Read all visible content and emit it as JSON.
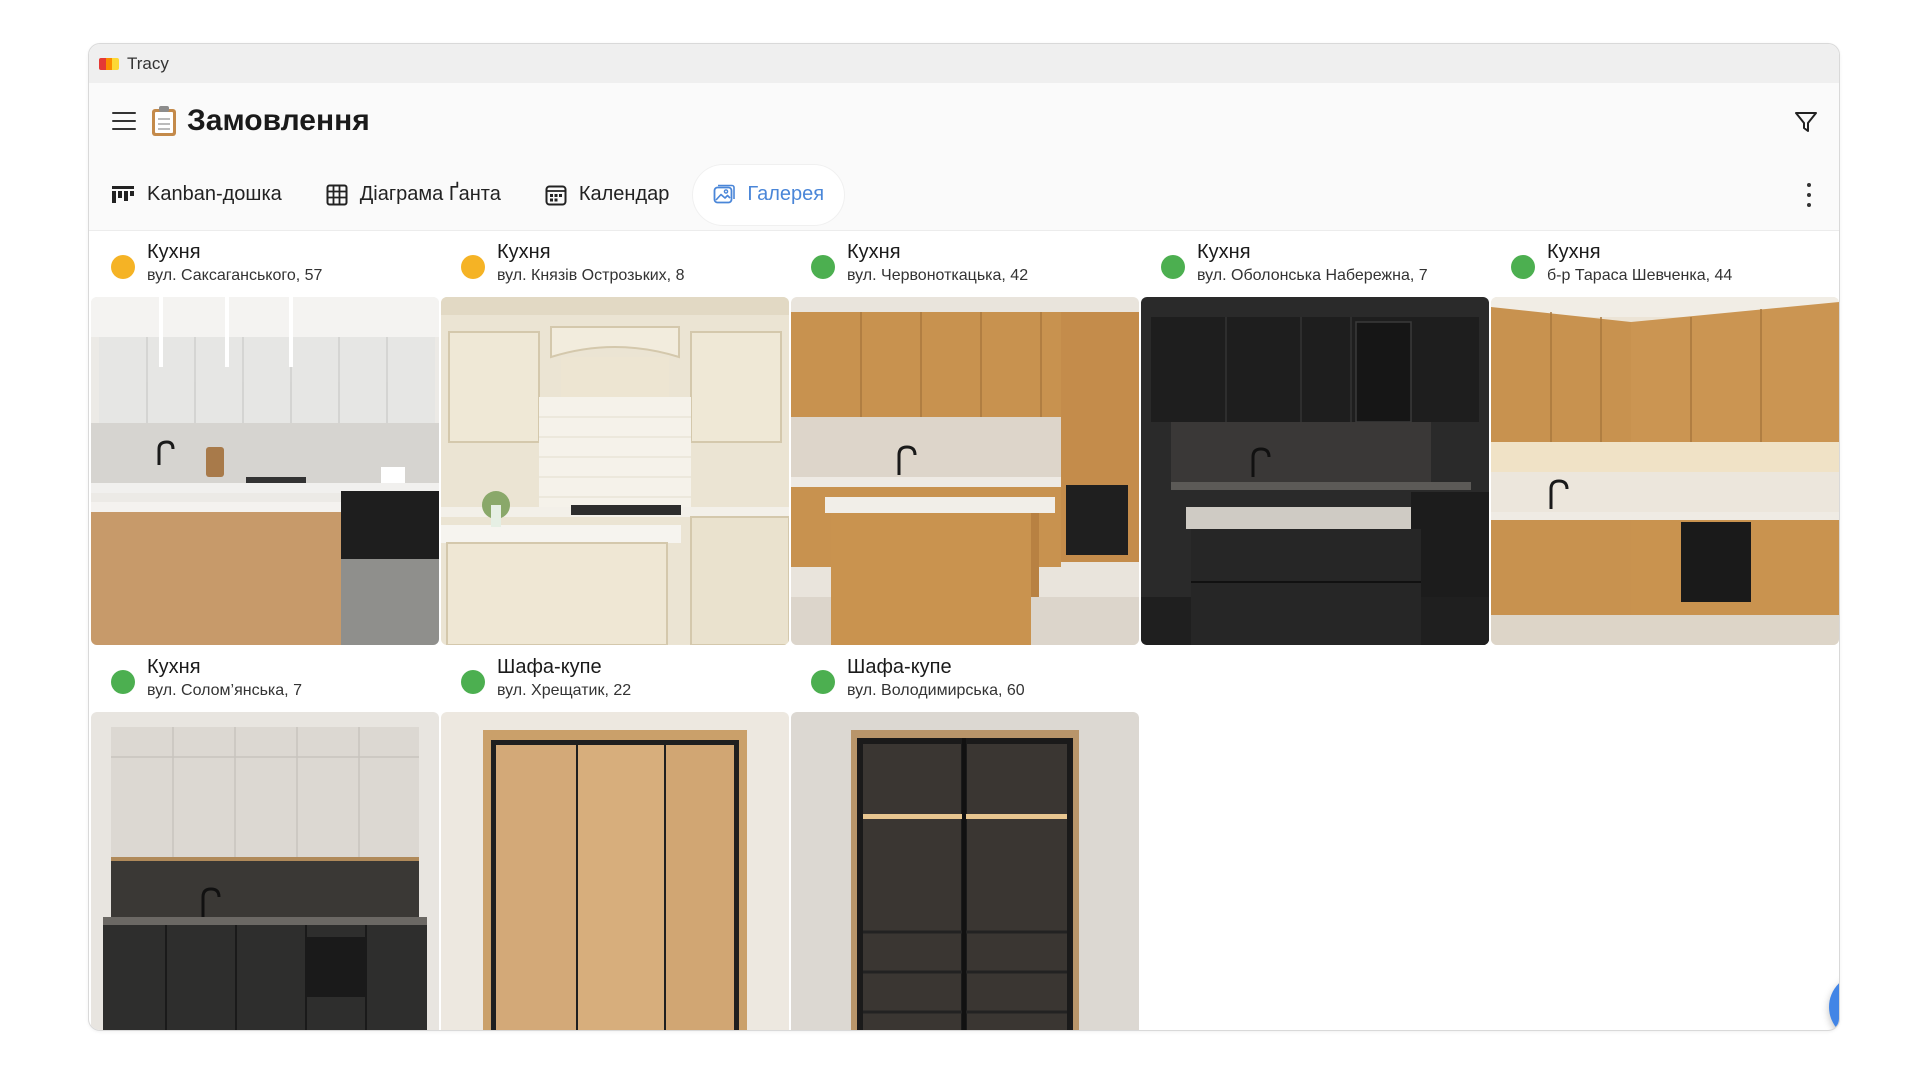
{
  "window": {
    "title": "Tracy"
  },
  "header": {
    "title": "Замовлення"
  },
  "tabs": [
    {
      "label": "Kanban-дошка",
      "icon": "kanban-icon",
      "active": false
    },
    {
      "label": "Діаграма Ґанта",
      "icon": "gantt-icon",
      "active": false
    },
    {
      "label": "Календар",
      "icon": "calendar-icon",
      "active": false
    },
    {
      "label": "Галерея",
      "icon": "gallery-icon",
      "active": true
    }
  ],
  "colors": {
    "accent": "#4a86d8",
    "status_pending": "#f5b325",
    "status_done": "#4caf50",
    "fab": "#4285e6"
  },
  "cards": [
    {
      "title": "Кухня",
      "address": "вул. Саксаганського, 57",
      "status": "pending",
      "image": "kitchen-white-island"
    },
    {
      "title": "Кухня",
      "address": "вул. Князів Острозьких, 8",
      "status": "pending",
      "image": "kitchen-classic-cream"
    },
    {
      "title": "Кухня",
      "address": "вул. Червоноткацька, 42",
      "status": "done",
      "image": "kitchen-oak-island"
    },
    {
      "title": "Кухня",
      "address": "вул. Оболонська Набережна, 7",
      "status": "done",
      "image": "kitchen-black"
    },
    {
      "title": "Кухня",
      "address": "б-р Тараса Шевченка, 44",
      "status": "done",
      "image": "kitchen-oak-corner"
    },
    {
      "title": "Кухня",
      "address": "вул. Солом’янська, 7",
      "status": "done",
      "image": "kitchen-white-grey"
    },
    {
      "title": "Шафа-купе",
      "address": "вул. Хрещатик, 22",
      "status": "done",
      "image": "wardrobe-oak"
    },
    {
      "title": "Шафа-купе",
      "address": "вул. Володимирська, 60",
      "status": "done",
      "image": "wardrobe-glass"
    }
  ],
  "fab": {
    "icon": "plus-icon"
  }
}
